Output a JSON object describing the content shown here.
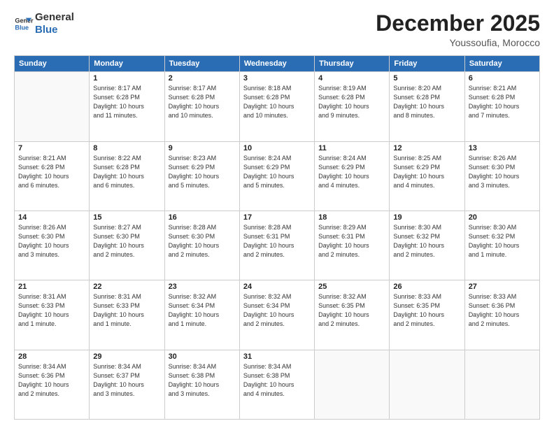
{
  "header": {
    "logo_line1": "General",
    "logo_line2": "Blue",
    "month_title": "December 2025",
    "location": "Youssoufia, Morocco"
  },
  "weekdays": [
    "Sunday",
    "Monday",
    "Tuesday",
    "Wednesday",
    "Thursday",
    "Friday",
    "Saturday"
  ],
  "weeks": [
    [
      {
        "day": "",
        "info": ""
      },
      {
        "day": "1",
        "info": "Sunrise: 8:17 AM\nSunset: 6:28 PM\nDaylight: 10 hours\nand 11 minutes."
      },
      {
        "day": "2",
        "info": "Sunrise: 8:17 AM\nSunset: 6:28 PM\nDaylight: 10 hours\nand 10 minutes."
      },
      {
        "day": "3",
        "info": "Sunrise: 8:18 AM\nSunset: 6:28 PM\nDaylight: 10 hours\nand 10 minutes."
      },
      {
        "day": "4",
        "info": "Sunrise: 8:19 AM\nSunset: 6:28 PM\nDaylight: 10 hours\nand 9 minutes."
      },
      {
        "day": "5",
        "info": "Sunrise: 8:20 AM\nSunset: 6:28 PM\nDaylight: 10 hours\nand 8 minutes."
      },
      {
        "day": "6",
        "info": "Sunrise: 8:21 AM\nSunset: 6:28 PM\nDaylight: 10 hours\nand 7 minutes."
      }
    ],
    [
      {
        "day": "7",
        "info": "Sunrise: 8:21 AM\nSunset: 6:28 PM\nDaylight: 10 hours\nand 6 minutes."
      },
      {
        "day": "8",
        "info": "Sunrise: 8:22 AM\nSunset: 6:28 PM\nDaylight: 10 hours\nand 6 minutes."
      },
      {
        "day": "9",
        "info": "Sunrise: 8:23 AM\nSunset: 6:29 PM\nDaylight: 10 hours\nand 5 minutes."
      },
      {
        "day": "10",
        "info": "Sunrise: 8:24 AM\nSunset: 6:29 PM\nDaylight: 10 hours\nand 5 minutes."
      },
      {
        "day": "11",
        "info": "Sunrise: 8:24 AM\nSunset: 6:29 PM\nDaylight: 10 hours\nand 4 minutes."
      },
      {
        "day": "12",
        "info": "Sunrise: 8:25 AM\nSunset: 6:29 PM\nDaylight: 10 hours\nand 4 minutes."
      },
      {
        "day": "13",
        "info": "Sunrise: 8:26 AM\nSunset: 6:30 PM\nDaylight: 10 hours\nand 3 minutes."
      }
    ],
    [
      {
        "day": "14",
        "info": "Sunrise: 8:26 AM\nSunset: 6:30 PM\nDaylight: 10 hours\nand 3 minutes."
      },
      {
        "day": "15",
        "info": "Sunrise: 8:27 AM\nSunset: 6:30 PM\nDaylight: 10 hours\nand 2 minutes."
      },
      {
        "day": "16",
        "info": "Sunrise: 8:28 AM\nSunset: 6:30 PM\nDaylight: 10 hours\nand 2 minutes."
      },
      {
        "day": "17",
        "info": "Sunrise: 8:28 AM\nSunset: 6:31 PM\nDaylight: 10 hours\nand 2 minutes."
      },
      {
        "day": "18",
        "info": "Sunrise: 8:29 AM\nSunset: 6:31 PM\nDaylight: 10 hours\nand 2 minutes."
      },
      {
        "day": "19",
        "info": "Sunrise: 8:30 AM\nSunset: 6:32 PM\nDaylight: 10 hours\nand 2 minutes."
      },
      {
        "day": "20",
        "info": "Sunrise: 8:30 AM\nSunset: 6:32 PM\nDaylight: 10 hours\nand 1 minute."
      }
    ],
    [
      {
        "day": "21",
        "info": "Sunrise: 8:31 AM\nSunset: 6:33 PM\nDaylight: 10 hours\nand 1 minute."
      },
      {
        "day": "22",
        "info": "Sunrise: 8:31 AM\nSunset: 6:33 PM\nDaylight: 10 hours\nand 1 minute."
      },
      {
        "day": "23",
        "info": "Sunrise: 8:32 AM\nSunset: 6:34 PM\nDaylight: 10 hours\nand 1 minute."
      },
      {
        "day": "24",
        "info": "Sunrise: 8:32 AM\nSunset: 6:34 PM\nDaylight: 10 hours\nand 2 minutes."
      },
      {
        "day": "25",
        "info": "Sunrise: 8:32 AM\nSunset: 6:35 PM\nDaylight: 10 hours\nand 2 minutes."
      },
      {
        "day": "26",
        "info": "Sunrise: 8:33 AM\nSunset: 6:35 PM\nDaylight: 10 hours\nand 2 minutes."
      },
      {
        "day": "27",
        "info": "Sunrise: 8:33 AM\nSunset: 6:36 PM\nDaylight: 10 hours\nand 2 minutes."
      }
    ],
    [
      {
        "day": "28",
        "info": "Sunrise: 8:34 AM\nSunset: 6:36 PM\nDaylight: 10 hours\nand 2 minutes."
      },
      {
        "day": "29",
        "info": "Sunrise: 8:34 AM\nSunset: 6:37 PM\nDaylight: 10 hours\nand 3 minutes."
      },
      {
        "day": "30",
        "info": "Sunrise: 8:34 AM\nSunset: 6:38 PM\nDaylight: 10 hours\nand 3 minutes."
      },
      {
        "day": "31",
        "info": "Sunrise: 8:34 AM\nSunset: 6:38 PM\nDaylight: 10 hours\nand 4 minutes."
      },
      {
        "day": "",
        "info": ""
      },
      {
        "day": "",
        "info": ""
      },
      {
        "day": "",
        "info": ""
      }
    ]
  ]
}
